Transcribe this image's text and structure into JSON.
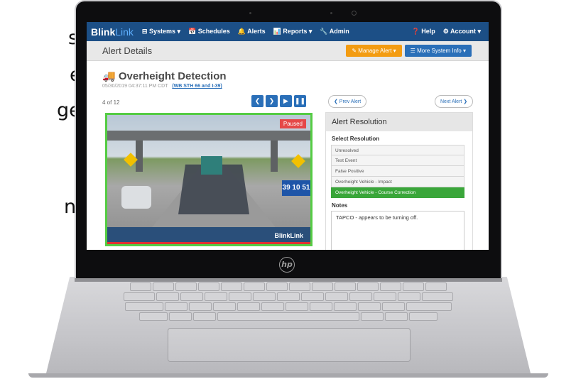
{
  "background_text": [
    "se,",
    "es",
    "gent",
    "nd"
  ],
  "device": {
    "logo": "hp"
  },
  "nav": {
    "brand_bold": "Blink",
    "brand_light": "Link",
    "items": [
      "⊟ Systems ▾",
      "📅 Schedules",
      "🔔 Alerts",
      "📊 Reports ▾",
      "🔧 Admin"
    ],
    "right": [
      "❓ Help",
      "⚙ Account ▾"
    ]
  },
  "subheader": {
    "title": "Alert Details",
    "manage": "✎ Manage Alert ▾",
    "more": "☰ More System Info ▾"
  },
  "alert": {
    "title": "Overheight Detection",
    "timestamp": "05/30/2019 04:37:11 PM CDT",
    "location": "(WB STH 66 and I-39)",
    "counter": "4 of 12"
  },
  "controls": [
    "❮",
    "❯",
    "▶",
    "❚❚"
  ],
  "camera": {
    "status": "Paused",
    "brand": "BlinkLink",
    "route": "39 10 51"
  },
  "pager": {
    "prev": "❮ Prev Alert",
    "next": "Next Alert ❯"
  },
  "resolution": {
    "title": "Alert Resolution",
    "select_label": "Select Resolution",
    "options": [
      "Unresolved",
      "Test Event",
      "False Positive",
      "Overheight Vehicle - Impact",
      "Overheight Vehicle - Course Correction"
    ],
    "selected": "Overheight Vehicle - Course Correction"
  },
  "notes": {
    "label": "Notes",
    "value": "TAPCO - appears to be turning off."
  },
  "colors": {
    "navbar": "#1c4f86",
    "accent_blue": "#2a6fb8",
    "orange": "#f39c12",
    "selected_green": "#3aa63a"
  }
}
